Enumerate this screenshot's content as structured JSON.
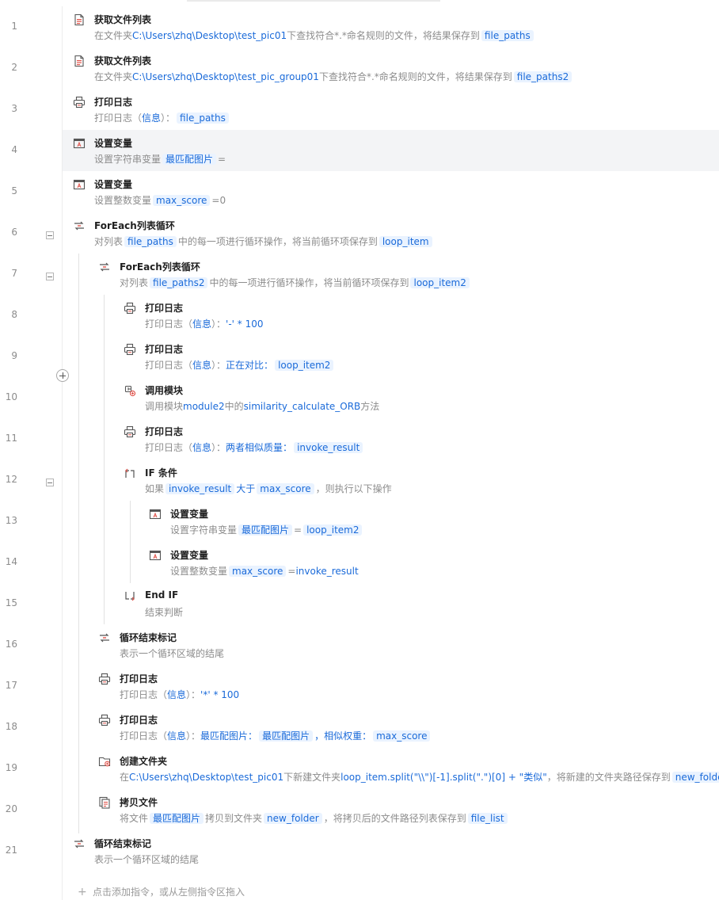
{
  "footer": {
    "hint": "点击添加指令，或从左侧指令区拖入"
  },
  "steps": [
    {
      "n": "1",
      "icon": "file-list-icon",
      "title": "获取文件列表",
      "segs": [
        [
          "t",
          "在文件夹"
        ],
        [
          "b",
          "C:\\Users\\zhq\\Desktop\\test_pic01"
        ],
        [
          "t",
          "下查找符合*.*命名规则的文件，将结果保存到"
        ],
        [
          "c",
          "file_paths"
        ]
      ]
    },
    {
      "n": "2",
      "icon": "file-list-icon",
      "title": "获取文件列表",
      "segs": [
        [
          "t",
          "在文件夹"
        ],
        [
          "b",
          "C:\\Users\\zhq\\Desktop\\test_pic_group01"
        ],
        [
          "t",
          "下查找符合*.*命名规则的文件，将结果保存到"
        ],
        [
          "c",
          "file_paths2"
        ]
      ]
    },
    {
      "n": "3",
      "icon": "printer-icon",
      "title": "打印日志",
      "segs": [
        [
          "t",
          "打印日志（"
        ],
        [
          "b",
          "信息"
        ],
        [
          "t",
          "）："
        ],
        [
          "c",
          "file_paths"
        ]
      ]
    },
    {
      "n": "4",
      "icon": "set-variable-icon",
      "title": "设置变量",
      "highlight": true,
      "segs": [
        [
          "t",
          "设置字符串变量"
        ],
        [
          "c",
          "最匹配图片"
        ],
        [
          "t",
          "="
        ]
      ]
    },
    {
      "n": "5",
      "icon": "set-variable-icon",
      "title": "设置变量",
      "segs": [
        [
          "t",
          "设置整数变量"
        ],
        [
          "c",
          "max_score"
        ],
        [
          "t",
          "=0"
        ]
      ]
    },
    {
      "n": "6",
      "icon": "loop-icon",
      "title": "ForEach列表循环",
      "collapsible": true,
      "segs": [
        [
          "t",
          "对列表"
        ],
        [
          "c",
          "file_paths"
        ],
        [
          "t",
          "中的每一项进行循环操作，将当前循环项保存到"
        ],
        [
          "c",
          "loop_item"
        ]
      ]
    },
    {
      "n": "7",
      "icon": "loop-icon",
      "title": "ForEach列表循环",
      "collapsible": true,
      "segs": [
        [
          "t",
          "对列表"
        ],
        [
          "c",
          "file_paths2"
        ],
        [
          "t",
          "中的每一项进行循环操作，将当前循环项保存到"
        ],
        [
          "c",
          "loop_item2"
        ]
      ]
    },
    {
      "n": "8",
      "icon": "printer-icon",
      "title": "打印日志",
      "segs": [
        [
          "t",
          "打印日志（"
        ],
        [
          "b",
          "信息"
        ],
        [
          "t",
          "）："
        ],
        [
          "b",
          "'-' * 100"
        ]
      ]
    },
    {
      "n": "9",
      "icon": "printer-icon",
      "title": "打印日志",
      "segs": [
        [
          "t",
          "打印日志（"
        ],
        [
          "b",
          "信息"
        ],
        [
          "t",
          "）："
        ],
        [
          "b",
          "正在对比："
        ],
        [
          "c",
          "loop_item2"
        ]
      ]
    },
    {
      "n": "10",
      "icon": "module-icon",
      "title": "调用模块",
      "segs": [
        [
          "t",
          "调用模块"
        ],
        [
          "b",
          "module2"
        ],
        [
          "t",
          "中的"
        ],
        [
          "b",
          "similarity_calculate_ORB"
        ],
        [
          "t",
          "方法"
        ]
      ]
    },
    {
      "n": "11",
      "icon": "printer-icon",
      "title": "打印日志",
      "segs": [
        [
          "t",
          "打印日志（"
        ],
        [
          "b",
          "信息"
        ],
        [
          "t",
          "）："
        ],
        [
          "b",
          "两者相似质量："
        ],
        [
          "c",
          "invoke_result"
        ]
      ]
    },
    {
      "n": "12",
      "icon": "if-icon",
      "title": "IF 条件",
      "collapsible": true,
      "segs": [
        [
          "t",
          "如果"
        ],
        [
          "c",
          "invoke_result"
        ],
        [
          "b",
          "大于"
        ],
        [
          "c",
          "max_score"
        ],
        [
          "t",
          "，则执行以下操作"
        ]
      ]
    },
    {
      "n": "13",
      "icon": "set-variable-icon",
      "title": "设置变量",
      "segs": [
        [
          "t",
          "设置字符串变量"
        ],
        [
          "c",
          "最匹配图片"
        ],
        [
          "t",
          "="
        ],
        [
          "c",
          "loop_item2"
        ]
      ]
    },
    {
      "n": "14",
      "icon": "set-variable-icon",
      "title": "设置变量",
      "segs": [
        [
          "t",
          "设置整数变量"
        ],
        [
          "c",
          "max_score"
        ],
        [
          "t",
          "="
        ],
        [
          "b",
          "invoke_result"
        ]
      ]
    },
    {
      "n": "15",
      "icon": "end-if-icon",
      "title": "End IF",
      "segs": [
        [
          "t",
          "结束判断"
        ]
      ]
    },
    {
      "n": "16",
      "icon": "loop-end-icon",
      "title": "循环结束标记",
      "segs": [
        [
          "t",
          "表示一个循环区域的结尾"
        ]
      ]
    },
    {
      "n": "17",
      "icon": "printer-icon",
      "title": "打印日志",
      "segs": [
        [
          "t",
          "打印日志（"
        ],
        [
          "b",
          "信息"
        ],
        [
          "t",
          "）："
        ],
        [
          "b",
          "'*' * 100"
        ]
      ]
    },
    {
      "n": "18",
      "icon": "printer-icon",
      "title": "打印日志",
      "segs": [
        [
          "t",
          "打印日志（"
        ],
        [
          "b",
          "信息"
        ],
        [
          "t",
          "）："
        ],
        [
          "b",
          "最匹配图片："
        ],
        [
          "c",
          "最匹配图片"
        ],
        [
          "b",
          "，相似权重："
        ],
        [
          "c",
          "max_score"
        ]
      ]
    },
    {
      "n": "19",
      "icon": "create-folder-icon",
      "title": "创建文件夹",
      "segs": [
        [
          "t",
          "在"
        ],
        [
          "b",
          "C:\\Users\\zhq\\Desktop\\test_pic01"
        ],
        [
          "t",
          "下新建文件夹"
        ],
        [
          "b",
          "loop_item.split(\"\\\\\")[-1].split(\".\")[0] + \"类似\""
        ],
        [
          "t",
          "，将新建的文件夹路径保存到"
        ],
        [
          "c",
          "new_folder"
        ]
      ]
    },
    {
      "n": "20",
      "icon": "copy-file-icon",
      "title": "拷贝文件",
      "segs": [
        [
          "t",
          "将文件"
        ],
        [
          "c",
          "最匹配图片"
        ],
        [
          "t",
          "拷贝到文件夹"
        ],
        [
          "c",
          "new_folder"
        ],
        [
          "t",
          "，将拷贝后的文件路径列表保存到"
        ],
        [
          "c",
          "file_list"
        ]
      ]
    },
    {
      "n": "21",
      "icon": "loop-end-icon",
      "title": "循环结束标记",
      "segs": [
        [
          "t",
          "表示一个循环区域的结尾"
        ]
      ]
    }
  ]
}
